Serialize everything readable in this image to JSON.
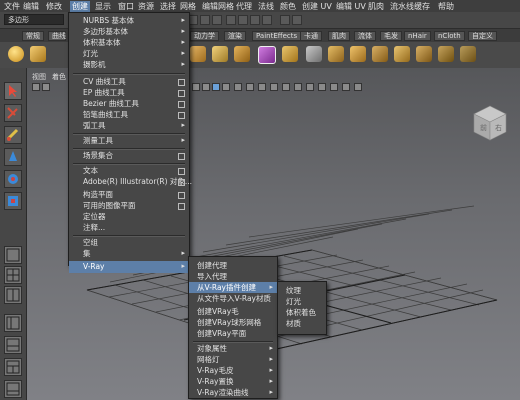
{
  "menubar": [
    "文件",
    "编辑",
    "修改",
    "创建",
    "显示",
    "窗口",
    "资源",
    "选择",
    "网格",
    "编辑网格",
    "代理",
    "法线",
    "颜色",
    "创建 UV",
    "编辑 UV",
    "肌肉",
    "流水线缓存",
    "帮助"
  ],
  "mode_select": "多边形",
  "shelf_tabs": [
    "常规",
    "曲线",
    "",
    "",
    "",
    "",
    "",
    "",
    "动力学",
    "渲染",
    "PaintEffects",
    "卡通",
    "肌肉",
    "流体",
    "毛发",
    "nHair",
    "nCloth",
    "自定义"
  ],
  "viewport_menu": [
    "视图",
    "着色"
  ],
  "view_cube": {
    "front": "前",
    "right": "右"
  },
  "create_menu": {
    "items": [
      {
        "label": "NURBS 基本体",
        "suffix": "arrow"
      },
      {
        "label": "多边形基本体",
        "suffix": "arrow"
      },
      {
        "label": "体积基本体",
        "suffix": "arrow"
      },
      {
        "label": "灯光",
        "suffix": "arrow"
      },
      {
        "label": "摄影机",
        "suffix": "arrow"
      },
      {
        "label": "CV 曲线工具",
        "suffix": "box"
      },
      {
        "label": "EP 曲线工具",
        "suffix": "box"
      },
      {
        "label": "Bezier 曲线工具",
        "suffix": "box"
      },
      {
        "label": "铅笔曲线工具",
        "suffix": "box"
      },
      {
        "label": "弧工具",
        "suffix": "arrow"
      },
      {
        "label": "测量工具",
        "suffix": "arrow"
      },
      {
        "label": "场景集合",
        "suffix": "box"
      },
      {
        "label": "文本",
        "suffix": "box"
      },
      {
        "label": "Adobe(R) Illustrator(R) 对象...",
        "suffix": "box"
      },
      {
        "label": "构造平面",
        "suffix": "box"
      },
      {
        "label": "可用的图像平面",
        "suffix": "box"
      },
      {
        "label": "定位器",
        "suffix": ""
      },
      {
        "label": "注释...",
        "suffix": ""
      },
      {
        "label": "空组",
        "suffix": ""
      },
      {
        "label": "集",
        "suffix": "arrow"
      },
      {
        "label": "V-Ray",
        "suffix": "arrow"
      }
    ]
  },
  "vray_menu": {
    "items": [
      {
        "label": "创建代理",
        "suffix": ""
      },
      {
        "label": "导入代理",
        "suffix": ""
      },
      {
        "label": "从V-Ray插件创建",
        "suffix": "arrow"
      },
      {
        "label": "从文件导入V-Ray材质",
        "suffix": ""
      },
      {
        "label": "创建VRay毛",
        "suffix": ""
      },
      {
        "label": "创建VRay球形网格",
        "suffix": ""
      },
      {
        "label": "创建VRay平面",
        "suffix": ""
      },
      {
        "label": "对象属性",
        "suffix": "arrow"
      },
      {
        "label": "网格灯",
        "suffix": "arrow"
      },
      {
        "label": "V-Ray毛皮",
        "suffix": "arrow"
      },
      {
        "label": "V-Ray置换",
        "suffix": "arrow"
      },
      {
        "label": "V-Ray渲染曲线",
        "suffix": "arrow"
      }
    ]
  },
  "plugin_menu": {
    "items": [
      "纹理",
      "灯光",
      "体积着色",
      "材质"
    ]
  },
  "colors": {
    "highlight": "#5d7fa8",
    "menu_bg": "#474747"
  }
}
